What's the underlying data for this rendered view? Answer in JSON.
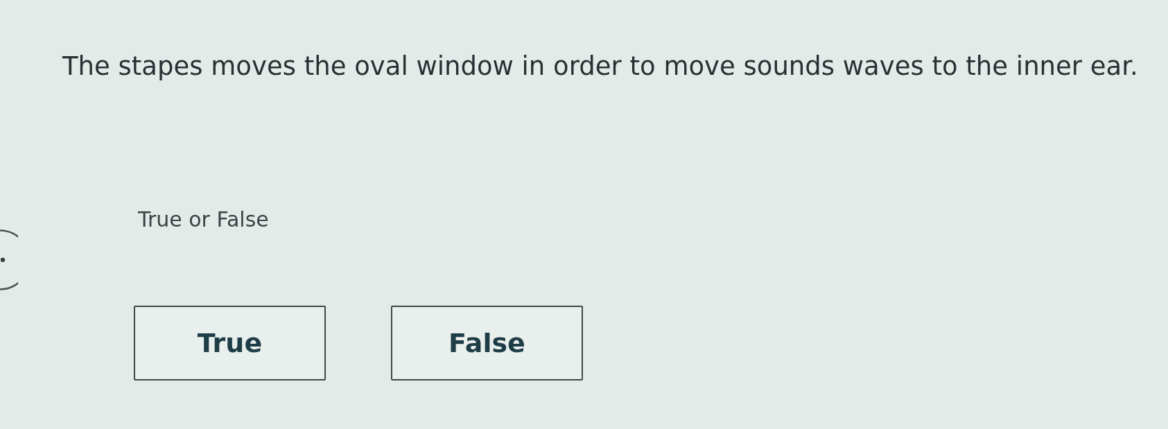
{
  "question": {
    "text": "The stapes moves the oval window in order to move sounds waves to the inner ear."
  },
  "instruction": "True or False",
  "options": [
    {
      "label": "True",
      "selected": false
    },
    {
      "label": "False",
      "selected": false
    }
  ]
}
